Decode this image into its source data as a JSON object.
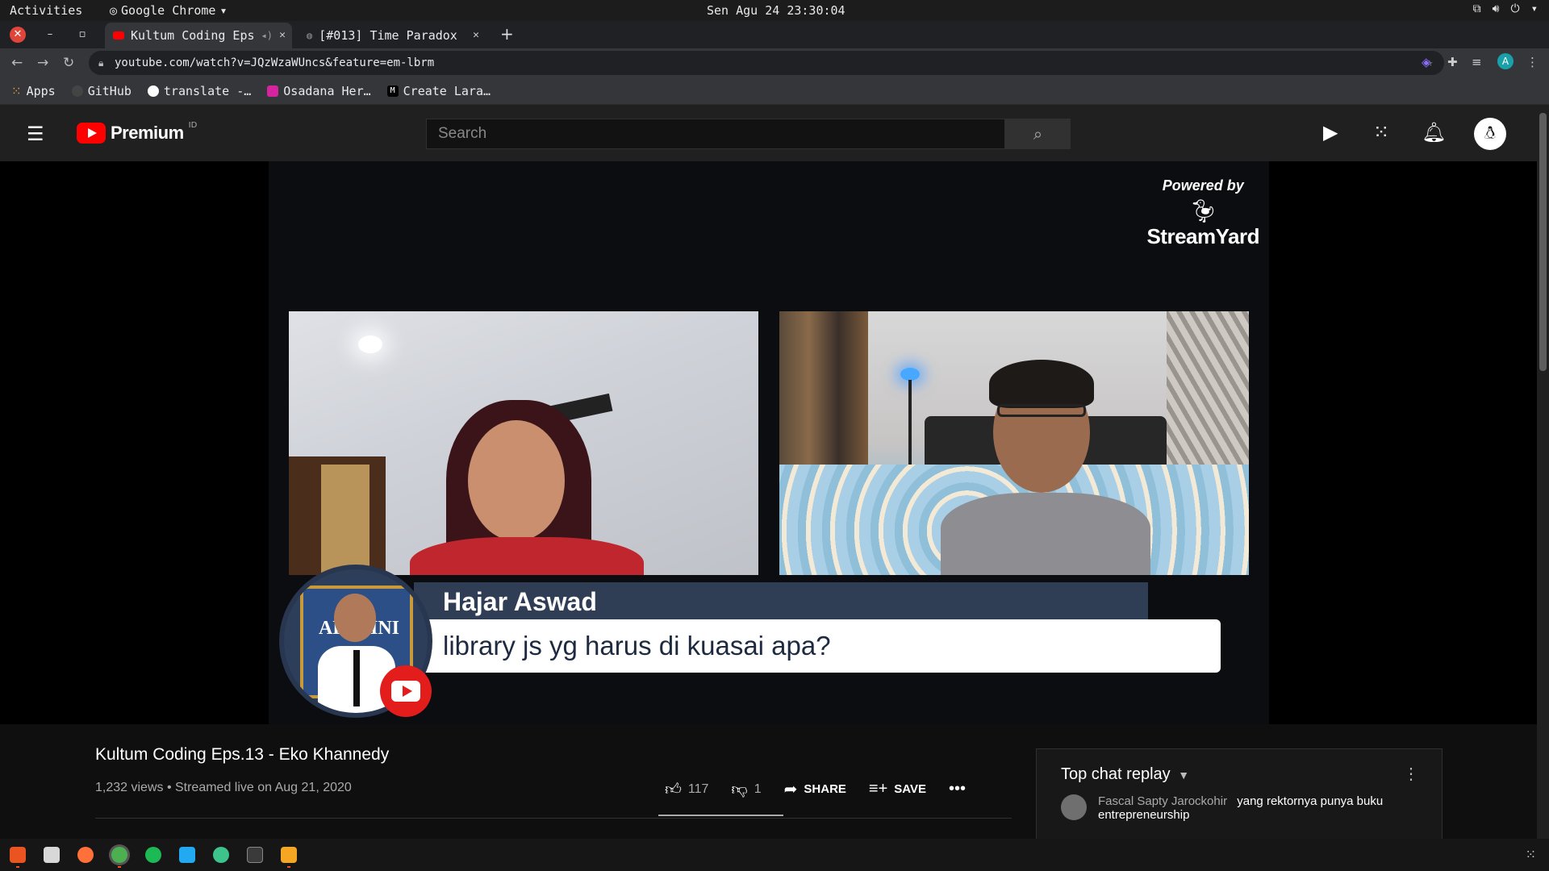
{
  "system": {
    "activities": "Activities",
    "app_name": "Google Chrome",
    "clock": "Sen Agu 24 23:30:04"
  },
  "browser": {
    "tabs": [
      {
        "label": "Kultum Coding Eps",
        "active": true
      },
      {
        "label": "[#013] Time Paradox",
        "active": false
      }
    ],
    "url": "youtube.com/watch?v=JQzWzaWUncs&feature=em-lbrm",
    "bookmarks": [
      "Apps",
      "GitHub",
      "translate -…",
      "Osadana Her…",
      "Create Lara…"
    ],
    "profile_initial": "A"
  },
  "youtube": {
    "logo_text": "Premium",
    "country": "ID",
    "search_placeholder": "Search"
  },
  "player": {
    "powered_by": "Powered by",
    "brand": "StreamYard",
    "comment_author": "Hajar Aswad",
    "comment_text": "library js yg harus di kuasai apa?",
    "avatar_caption": "ALUMNI"
  },
  "video": {
    "title": "Kultum Coding Eps.13 - Eko Khannedy",
    "meta": "1,232 views • Streamed live on Aug 21, 2020",
    "likes": "117",
    "dislikes": "1",
    "share_label": "SHARE",
    "save_label": "SAVE"
  },
  "chat": {
    "header": "Top chat replay",
    "messages": [
      {
        "author": "Fascal Sapty Jarockohir",
        "text": "yang rektornya punya buku entrepreneurship"
      }
    ]
  },
  "colors": {
    "youtube_red": "#ff0000",
    "banner_name_bg": "#2f3d55",
    "ubuntu_orange": "#e95420"
  }
}
